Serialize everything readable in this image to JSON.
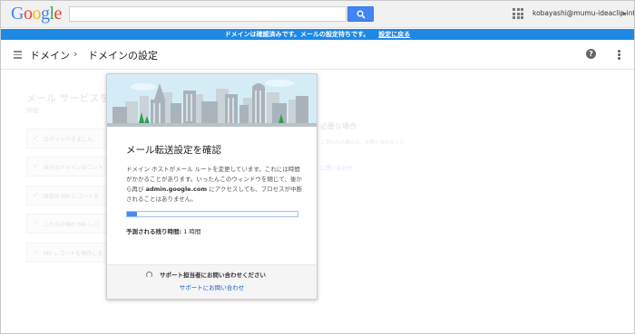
{
  "gbar": {
    "logo_letters": [
      {
        "ch": "G",
        "color": "#4285f4"
      },
      {
        "ch": "o",
        "color": "#ea4335"
      },
      {
        "ch": "o",
        "color": "#fbbc05"
      },
      {
        "ch": "g",
        "color": "#4285f4"
      },
      {
        "ch": "l",
        "color": "#34a853"
      },
      {
        "ch": "e",
        "color": "#ea4335"
      }
    ],
    "search_value": "",
    "search_icon": "search-icon",
    "apps_icon": "apps-grid-icon",
    "account": "kobayashi@mumu-ideaclip.info"
  },
  "notice": {
    "text": "ドメインは確認済みです。メールの設定待ちです。",
    "link": "設定に戻る",
    "color": "#1e88e5"
  },
  "header": {
    "breadcrumb_1": "ドメイン",
    "separator": "›",
    "breadcrumb_2": "ドメインの設定",
    "help_glyph": "?"
  },
  "background": {
    "title": "メール サービスを",
    "detail_link": "詳細",
    "steps": [
      "ログインできました。",
      "自分のドメインのコント",
      "既存の MX レコードを",
      "これらの値の MX レコ",
      "MX レコードを保存しま"
    ],
    "right_title": "必要な場合",
    "right_line": "と思われる場合は、お問い合わせくだ",
    "right_link": "に問い合わせ"
  },
  "dialog": {
    "title": "メール転送設定を確認",
    "body_1": "ドメイン ホストがメール ルートを変更しています。これには時間がかかることがあります。いったんこのウィンドウを閉じて、後から再び ",
    "body_bold": "admin.google.com",
    "body_2": " にアクセスしても、プロセスが中断されることはありません。",
    "progress_percent": 6,
    "eta_label": "予測される残り時間:",
    "eta_value": " 1 時間",
    "support_text": "サポート担当者にお問い合わせください",
    "support_link": "サポートにお問い合わせ",
    "accent_color": "#4a8af4"
  }
}
